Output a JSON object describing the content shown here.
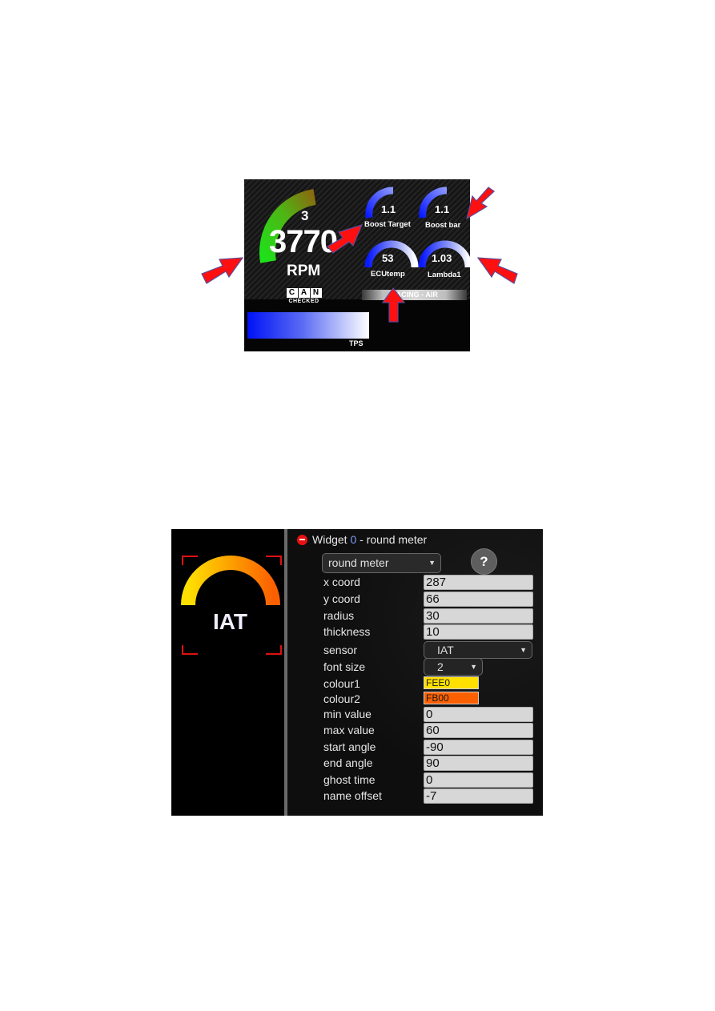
{
  "dashboard": {
    "rpm": {
      "gear": "3",
      "value": "3770",
      "label": "RPM",
      "gauge_colors": [
        "#1fe01a",
        "#8a6a10"
      ]
    },
    "can_logo": {
      "letters": [
        "C",
        "A",
        "N"
      ],
      "subtitle": "CHECKED"
    },
    "small_gauges": [
      {
        "value": "1.1",
        "label": "Boost Target"
      },
      {
        "value": "1.1",
        "label": "Boost bar"
      },
      {
        "value": "53",
        "label": "ECUtemp"
      },
      {
        "value": "1.03",
        "label": "Lambda1"
      }
    ],
    "status_bar": {
      "text": "RACING - AIR",
      "visible_text": "ING - AIR"
    },
    "tps": {
      "label": "TPS",
      "bar_colors": [
        "#0012f5",
        "#ffffff"
      ]
    },
    "arrow_color": "#ff0000"
  },
  "config": {
    "preview": {
      "gauge_label": "IAT",
      "gauge_colors": [
        "#fee000",
        "#fb6000"
      ],
      "selection_color": "#e01010"
    },
    "widget": {
      "title_prefix": "Widget ",
      "index": "0",
      "title_suffix": " - round meter",
      "type_select": "round meter",
      "help_label": "?"
    },
    "fields": [
      {
        "label": "x coord",
        "value": "287",
        "kind": "input"
      },
      {
        "label": "y coord",
        "value": "66",
        "kind": "input"
      },
      {
        "label": "radius",
        "value": "30",
        "kind": "input"
      },
      {
        "label": "thickness",
        "value": "10",
        "kind": "input"
      },
      {
        "label": "sensor",
        "value": "IAT",
        "kind": "select"
      },
      {
        "label": "font size",
        "value": "2",
        "kind": "select"
      },
      {
        "label": "colour1",
        "value": "FEE0",
        "kind": "color",
        "color": "#ffe000"
      },
      {
        "label": "colour2",
        "value": "FB00",
        "kind": "color",
        "color": "#fb6000"
      },
      {
        "label": "min value",
        "value": "0",
        "kind": "input"
      },
      {
        "label": "max value",
        "value": "60",
        "kind": "input"
      },
      {
        "label": "start angle",
        "value": "-90",
        "kind": "input"
      },
      {
        "label": "end angle",
        "value": "90",
        "kind": "input"
      },
      {
        "label": "ghost time",
        "value": "0",
        "kind": "input"
      },
      {
        "label": "name offset",
        "value": "-7",
        "kind": "input"
      }
    ]
  }
}
